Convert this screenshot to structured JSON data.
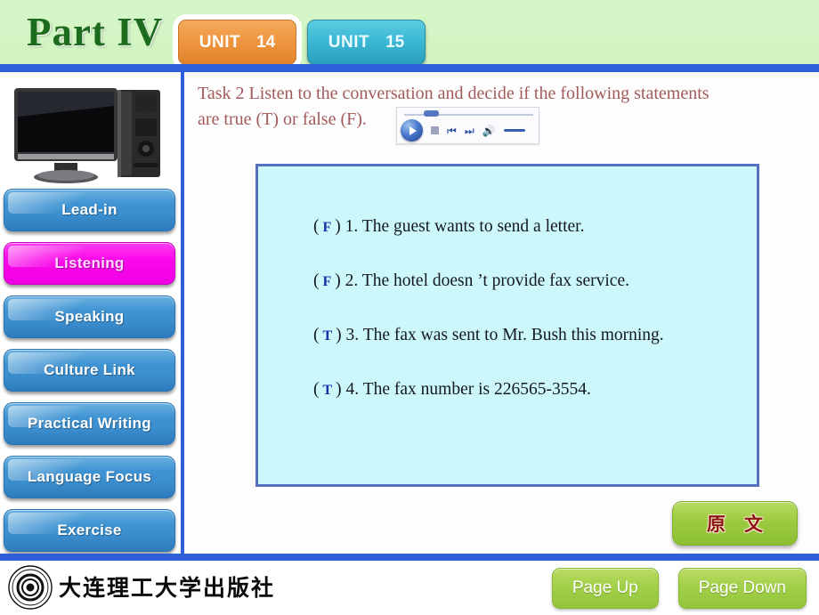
{
  "header": {
    "part_title": "Part IV",
    "tabs": [
      {
        "word": "UNIT",
        "number": "14",
        "color": "#ef9540",
        "active": true
      },
      {
        "word": "UNIT",
        "number": "15",
        "color": "#3bb8d4",
        "active": false
      }
    ]
  },
  "sidebar": {
    "image_caption": "desktop-computer-photo",
    "items": [
      {
        "label": "Lead-in",
        "active": false
      },
      {
        "label": "Listening",
        "active": true
      },
      {
        "label": "Speaking",
        "active": false
      },
      {
        "label": "Culture Link",
        "active": false
      },
      {
        "label": "Practical Writing",
        "active": false
      },
      {
        "label": "Language Focus",
        "active": false
      },
      {
        "label": "Exercise",
        "active": false
      }
    ],
    "active_color": "#f200e2",
    "normal_color": "#3c8fcf"
  },
  "main": {
    "task_line1": "Task 2 Listen to the conversation and decide if the following statements",
    "task_line2": "are true (T) or false (F).",
    "task_color": "#a25a5a",
    "player": {
      "play_label": "play-button",
      "stop_label": "stop-button",
      "prev_label": "previous-track-button",
      "next_label": "next-track-button",
      "volume_label": "volume-button",
      "slider_label": "volume-slider"
    },
    "statements": [
      {
        "answer": "F",
        "text": "1. The guest wants to send a letter."
      },
      {
        "answer": "F",
        "text": "2. The hotel doesn ’t provide fax service."
      },
      {
        "answer": "T",
        "text": "3. The fax was sent to Mr. Bush this morning."
      },
      {
        "answer": "T",
        "text": "4. The fax number is 226565-3554."
      }
    ],
    "box_bg": "#ccf8fb",
    "box_border": "#5570c0",
    "original_text_button": "原　文"
  },
  "footer": {
    "publisher": "大连理工大学出版社",
    "page_up": "Page Up",
    "page_down": "Page Down"
  }
}
